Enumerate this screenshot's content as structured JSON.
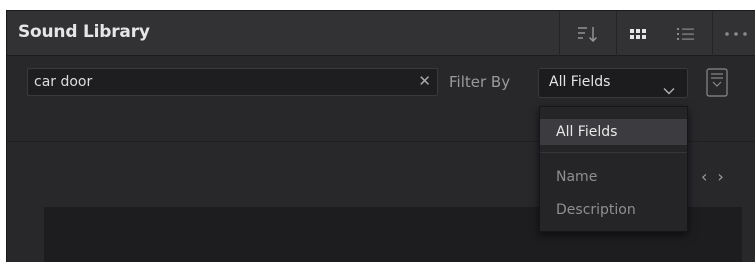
{
  "panel": {
    "title": "Sound Library"
  },
  "header": {
    "icons": {
      "sort": "sort-icon",
      "grid_view": "grid-view-icon",
      "list_view": "list-view-icon",
      "more": "more-options-icon"
    }
  },
  "search": {
    "value": "car door",
    "clear_icon": "close-icon"
  },
  "filter": {
    "label": "Filter By",
    "selected": "All Fields",
    "options": [
      "All Fields",
      "Name",
      "Description"
    ]
  },
  "nav": {
    "prev": "‹",
    "next": "›"
  },
  "colors": {
    "panel_bg": "#28282b",
    "header_bg": "#323235",
    "text": "#e6e6e6",
    "muted": "#8f8f8f"
  }
}
